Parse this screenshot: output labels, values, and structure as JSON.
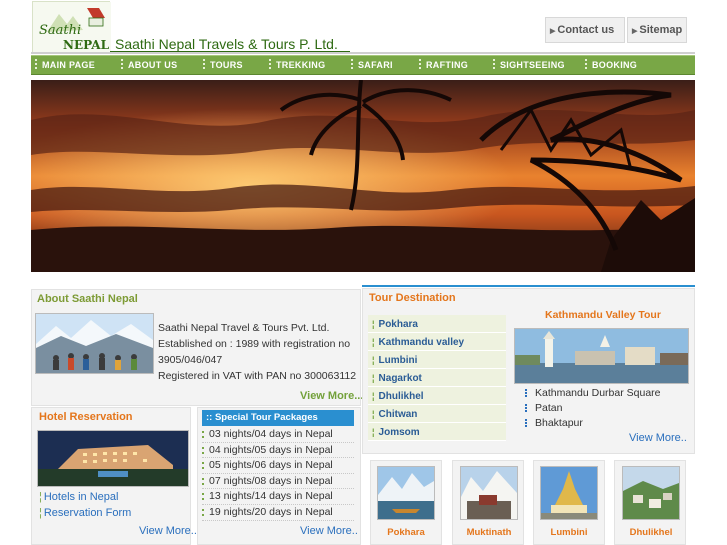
{
  "header": {
    "company_name": "Saathi Nepal Travels & Tours P. Ltd.",
    "logo_text": "Saathi NEPAL",
    "contact_label": "Contact us",
    "sitemap_label": "Sitemap"
  },
  "nav": {
    "items": [
      "MAIN PAGE",
      "ABOUT US",
      "TOURS",
      "TREKKING",
      "SAFARI",
      "RAFTING",
      "SIGHTSEEING",
      "BOOKING"
    ]
  },
  "about": {
    "title": "About Saathi Nepal",
    "lines": [
      "Saathi Nepal Travel & Tours Pvt. Ltd.",
      "Established on : 1989 with registration no",
      "3905/046/047",
      "Registered in VAT with PAN no 300063112"
    ],
    "view_more": "View More...."
  },
  "hotel": {
    "title": "Hotel Reservation",
    "links": [
      "Hotels in Nepal",
      "Reservation Form"
    ],
    "view_more": "View More.."
  },
  "packages": {
    "title": ":: Special Tour Packages",
    "items": [
      "03 nights/04 days in Nepal",
      "04 nights/05 days in Nepal",
      "05 nights/06 days in Nepal",
      "07 nights/08 days in Nepal",
      "13 nights/14 days in Nepal",
      "19 nights/20 days in Nepal"
    ],
    "view_more": "View More.."
  },
  "destinations": {
    "title": "Tour Destination",
    "items": [
      "Pokhara",
      "Kathmandu valley",
      "Lumbini",
      "Nagarkot",
      "Dhulikhel",
      "Chitwan",
      "Jomsom"
    ]
  },
  "kathmandu_tour": {
    "title": "Kathmandu Valley Tour",
    "items": [
      "Kathmandu Durbar Square",
      "Patan",
      "Bhaktapur"
    ],
    "view_more": "View More.."
  },
  "thumbnails": {
    "labels": [
      "Pokhara",
      "Muktinath",
      "Lumbini",
      "Dhulikhel"
    ]
  },
  "colors": {
    "nav_green": "#79a746",
    "title_green": "#7d9b35",
    "accent_orange": "#e4761c",
    "link_blue": "#2a6fbd",
    "package_header_blue": "#2a8fd0"
  }
}
